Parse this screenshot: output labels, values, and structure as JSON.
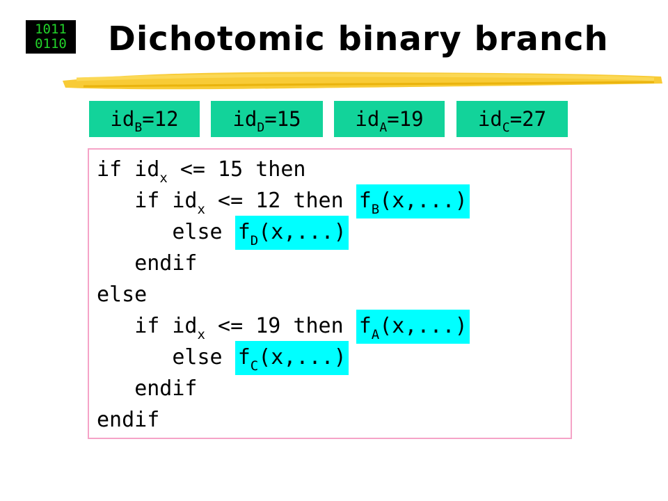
{
  "logo": {
    "line1": "1011",
    "line2": "0110"
  },
  "title": "Dichotomic binary branch",
  "ids": [
    {
      "prefix": "id",
      "sub": "B",
      "suffix": "=12"
    },
    {
      "prefix": "id",
      "sub": "D",
      "suffix": "=15"
    },
    {
      "prefix": "id",
      "sub": "A",
      "suffix": "=19"
    },
    {
      "prefix": "id",
      "sub": "C",
      "suffix": "=27"
    }
  ],
  "code": {
    "l1": {
      "a": "if id",
      "sub": "x",
      "b": " <= 15 then"
    },
    "l2": {
      "indent": "   ",
      "a": "if id",
      "sub": "x",
      "b": " <= 12 then ",
      "f": "f",
      "fsub": "B",
      "fargs": "(x,...)"
    },
    "l3": {
      "indent": "      ",
      "a": "else ",
      "f": "f",
      "fsub": "D",
      "fargs": "(x,...)"
    },
    "l4": {
      "indent": "   ",
      "a": "endif"
    },
    "l5": {
      "a": "else"
    },
    "l6": {
      "indent": "   ",
      "a": "if id",
      "sub": "x",
      "b": " <= 19 then ",
      "f": "f",
      "fsub": "A",
      "fargs": "(x,...)"
    },
    "l7": {
      "indent": "      ",
      "a": "else ",
      "f": "f",
      "fsub": "C",
      "fargs": "(x,...)"
    },
    "l8": {
      "indent": "   ",
      "a": "endif"
    },
    "l9": {
      "a": "endif"
    }
  },
  "colors": {
    "id_box": "#12d39a",
    "highlight": "#00ffff",
    "frame": "#f5a3c7",
    "stroke": "#f7c520",
    "logo_text": "#22d42a"
  }
}
